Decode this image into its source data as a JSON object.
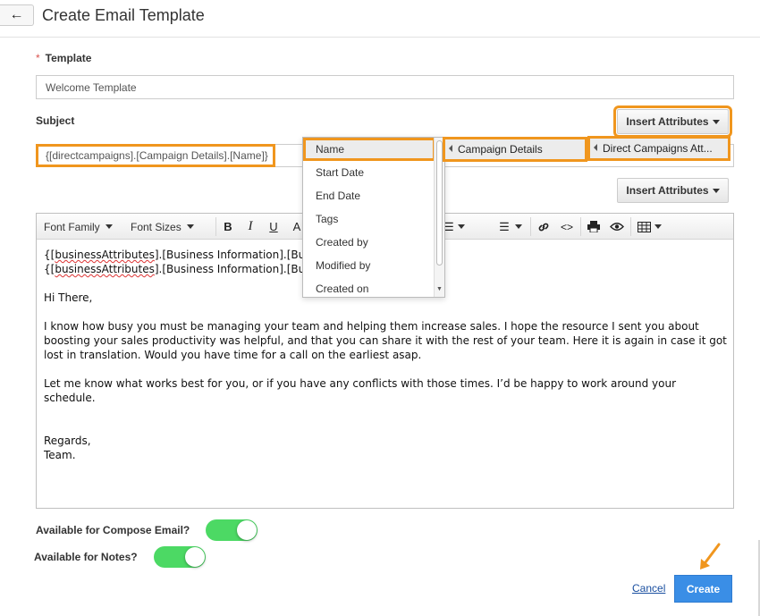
{
  "header": {
    "title": "Create Email Template",
    "back_icon": "arrow-left-icon"
  },
  "template": {
    "label": "Template",
    "required_mark": "*",
    "value": "Welcome Template"
  },
  "subject": {
    "label": "Subject",
    "value": "{[directcampaigns].[Campaign Details].[Name]}",
    "insert_label": "Insert Attributes"
  },
  "body_insert_label": "Insert Attributes",
  "attribute_dropdown": {
    "items": [
      "Name",
      "Start Date",
      "End Date",
      "Tags",
      "Created by",
      "Modified by",
      "Created on"
    ],
    "selected": "Name"
  },
  "submenus": {
    "campaign_details": "Campaign Details",
    "direct_campaigns": "Direct Campaigns Att..."
  },
  "editor": {
    "toolbar": {
      "font_family": "Font Family",
      "font_sizes": "Font Sizes",
      "bold": "B",
      "italic": "I",
      "underline": "U",
      "color": "A"
    },
    "lines": {
      "l1_pre": "{[",
      "l1_squig": "businessAttributes",
      "l1_post": "].[Business Information].[Bu",
      "l2_pre": "{[",
      "l2_squig": "businessAttributes",
      "l2_post": "].[Business Information].[Bu",
      "greeting": "Hi There,",
      "para1": "I know how busy you must be managing your team and helping them increase sales. I hope the resource I sent you about boosting your sales productivity was helpful, and that you can share it with the rest of your team. Here it is again in case it got lost in translation. Would you have time for a call on the earliest asap.",
      "para2": "Let me know what works best for you, or if you have any conflicts with those times. I’d be happy to work around your schedule.",
      "regards": "Regards,",
      "team": "Team."
    }
  },
  "compose_toggle": {
    "label": "Available for Compose Email?",
    "on": true
  },
  "notes_toggle": {
    "label": "Available for Notes?",
    "on": true
  },
  "actions": {
    "cancel": "Cancel",
    "create": "Create"
  },
  "colors": {
    "highlight": "#f0961e",
    "toggle_on": "#4cd964",
    "primary": "#3a8ee6",
    "link": "#1a4fa0"
  }
}
